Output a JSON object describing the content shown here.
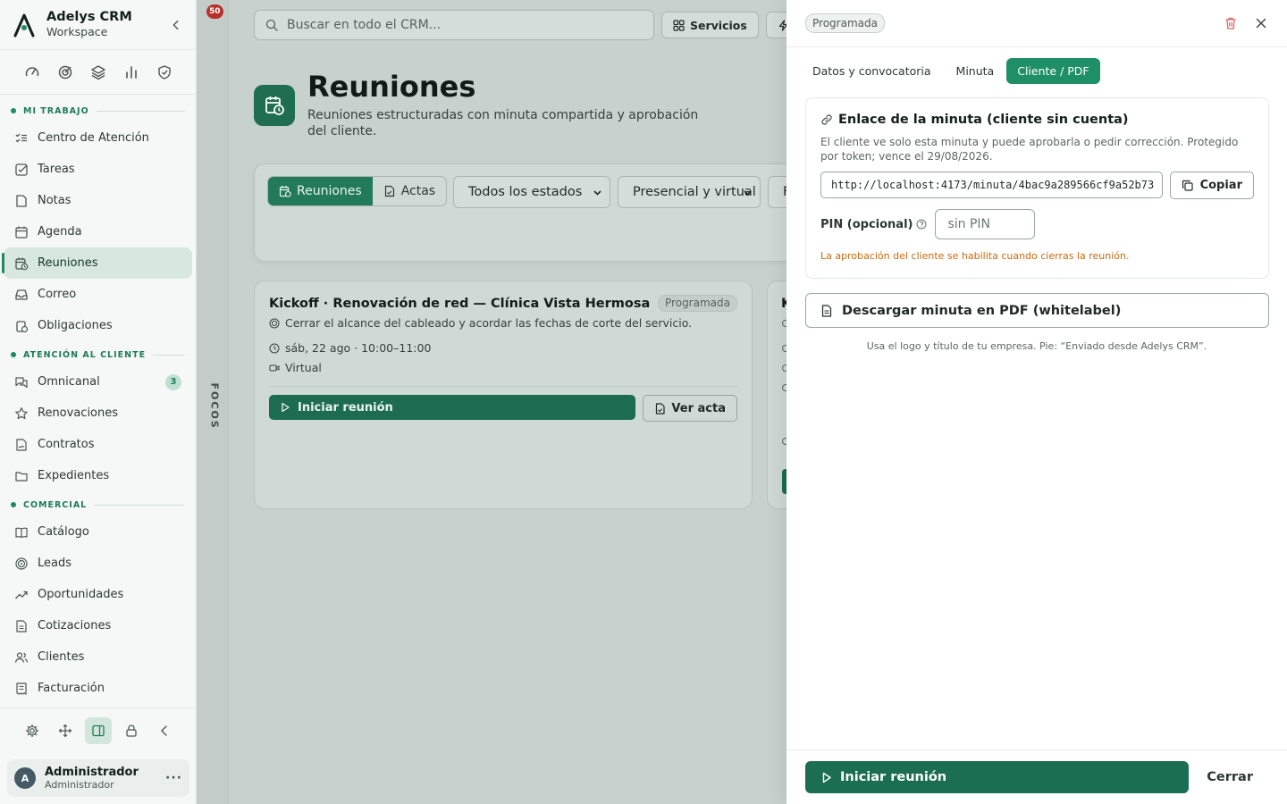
{
  "app": {
    "name": "Adelys CRM",
    "workspace": "Workspace"
  },
  "sidebar": {
    "sections": [
      {
        "label": "MI TRABAJO",
        "items": [
          {
            "label": "Centro de Atención",
            "icon": "list-check-icon"
          },
          {
            "label": "Tareas",
            "icon": "checkbox-icon"
          },
          {
            "label": "Notas",
            "icon": "note-icon"
          },
          {
            "label": "Agenda",
            "icon": "calendar-icon"
          },
          {
            "label": "Reuniones",
            "icon": "calendar-clock-icon",
            "active": true
          },
          {
            "label": "Correo",
            "icon": "inbox-icon"
          },
          {
            "label": "Obligaciones",
            "icon": "scale-icon"
          }
        ]
      },
      {
        "label": "ATENCIÓN AL CLIENTE",
        "items": [
          {
            "label": "Omnicanal",
            "icon": "chat-icon",
            "badge": "3"
          },
          {
            "label": "Renovaciones",
            "icon": "star-icon"
          },
          {
            "label": "Contratos",
            "icon": "contract-icon"
          },
          {
            "label": "Expedientes",
            "icon": "folder-icon"
          }
        ]
      },
      {
        "label": "COMERCIAL",
        "items": [
          {
            "label": "Catálogo",
            "icon": "book-icon"
          },
          {
            "label": "Leads",
            "icon": "target-icon"
          },
          {
            "label": "Oportunidades",
            "icon": "trend-icon"
          },
          {
            "label": "Cotizaciones",
            "icon": "quote-icon"
          },
          {
            "label": "Clientes",
            "icon": "users-icon"
          },
          {
            "label": "Facturación",
            "icon": "invoice-icon"
          }
        ]
      }
    ],
    "user": {
      "initial": "A",
      "name": "Administrador",
      "role": "Administrador"
    }
  },
  "focos": {
    "badge": "50",
    "label": "FOCOS"
  },
  "main": {
    "search_placeholder": "Buscar en todo el CRM...",
    "services_label": "Servicios",
    "title": "Reuniones",
    "description": "Reuniones estructuradas con minuta compartida y aprobación del cliente.",
    "view_tabs": [
      "Reuniones",
      "Actas"
    ],
    "status_filter": "Todos los estados",
    "mode_filter": "Presencial y virtual",
    "third_filter": "F",
    "card": {
      "title": "Kickoff · Renovación de red — Clínica Vista Hermosa",
      "status": "Programada",
      "goal": "Cerrar el alcance del cableado y acordar las fechas de corte del servicio.",
      "when": "sáb, 22 ago · 10:00–11:00",
      "mode": "Virtual",
      "start_label": "Iniciar reunión",
      "view_label": "Ver acta"
    },
    "card2_initial": "K"
  },
  "drawer": {
    "status": "Programada",
    "tabs": [
      "Datos y convocatoria",
      "Minuta",
      "Cliente / PDF"
    ],
    "active_tab": 2,
    "link_title": "Enlace de la minuta (cliente sin cuenta)",
    "link_desc": "El cliente ve solo esta minuta y puede aprobarla o pedir corrección. Protegido por token; vence el 29/08/2026.",
    "link_url": "http://localhost:4173/minuta/4bac9a289566cf9a52b73",
    "copy_label": "Copiar",
    "pin_label": "PIN (opcional)",
    "pin_placeholder": "sin PIN",
    "warning": "La aprobación del cliente se habilita cuando cierras la reunión.",
    "pdf_label": "Descargar minuta en PDF (whitelabel)",
    "pdf_hint": "Usa el logo y título de tu empresa. Pie: “Enviado desde Adelys CRM”.",
    "start_label": "Iniciar reunión",
    "close_label": "Cerrar"
  },
  "colors": {
    "brand": "#1d8a62",
    "primary_button": "#1c6e52",
    "warning": "#c96a0a",
    "danger": "#e06666"
  }
}
